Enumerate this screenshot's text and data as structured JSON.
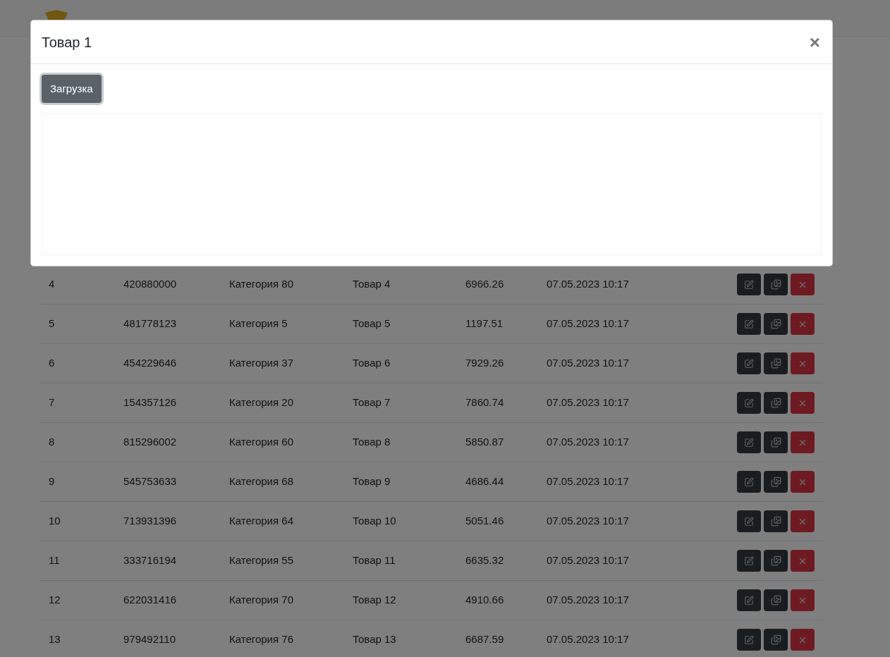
{
  "table": {
    "rows": [
      {
        "cells": [
          "4",
          "420880000",
          "Категория 80",
          "Товар 4",
          "6966.26",
          "07.05.2023 10:17"
        ]
      },
      {
        "cells": [
          "5",
          "481778123",
          "Категория 5",
          "Товар 5",
          "1197.51",
          "07.05.2023 10:17"
        ]
      },
      {
        "cells": [
          "6",
          "454229646",
          "Категория 37",
          "Товар 6",
          "7929.26",
          "07.05.2023 10:17"
        ]
      },
      {
        "cells": [
          "7",
          "154357126",
          "Категория 20",
          "Товар 7",
          "7860.74",
          "07.05.2023 10:17"
        ]
      },
      {
        "cells": [
          "8",
          "815296002",
          "Категория 60",
          "Товар 8",
          "5850.87",
          "07.05.2023 10:17"
        ]
      },
      {
        "cells": [
          "9",
          "545753633",
          "Категория 68",
          "Товар 9",
          "4686.44",
          "07.05.2023 10:17"
        ]
      },
      {
        "cells": [
          "10",
          "713931396",
          "Категория 64",
          "Товар 10",
          "5051.46",
          "07.05.2023 10:17"
        ]
      },
      {
        "cells": [
          "11",
          "333716194",
          "Категория 55",
          "Товар 11",
          "6635.32",
          "07.05.2023 10:17"
        ]
      },
      {
        "cells": [
          "12",
          "622031416",
          "Категория 70",
          "Товар 12",
          "4910.66",
          "07.05.2023 10:17"
        ]
      },
      {
        "cells": [
          "13",
          "979492110",
          "Категория 76",
          "Товар 13",
          "6687.59",
          "07.05.2023 10:17"
        ]
      }
    ]
  },
  "modal": {
    "title": "Товар 1",
    "close": "×",
    "upload_button": "Загрузка"
  }
}
